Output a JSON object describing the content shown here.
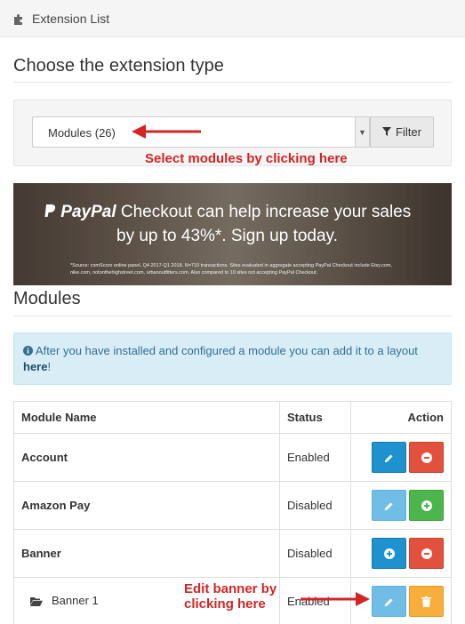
{
  "header": {
    "title": "Extension List",
    "icon": "puzzle-icon"
  },
  "choose": {
    "title": "Choose the extension type",
    "select_value": "Modules (26)",
    "filter_label": "Filter",
    "annotation": "Select modules by clicking here"
  },
  "banner": {
    "brand": "PayPal",
    "line1_rest": " Checkout can help increase your sales",
    "line2": "by up to 43%*. Sign up today.",
    "fineprint": "*Source: comScore online panel, Q4 2017-Q1 2018. N=710 transactions. Sites evaluated in aggregate accepting PayPal Checkout include Etsy.com, nike.com, notonthehighstreet.com, urbanoutfitters.com. Also compared to 10 sites not accepting PayPal Checkout."
  },
  "modules": {
    "title": "Modules",
    "alert_text": "After you have installed and configured a module you can add it to a layout",
    "alert_link": "here",
    "alert_suffix": "!",
    "columns": [
      "Module Name",
      "Status",
      "Action"
    ],
    "rows": [
      {
        "name": "Account",
        "status": "Enabled"
      },
      {
        "name": "Amazon Pay",
        "status": "Disabled"
      },
      {
        "name": "Banner",
        "status": "Disabled"
      },
      {
        "name": "Banner 1",
        "status": "Enabled"
      }
    ],
    "edit_annotation_line1": "Edit banner by",
    "edit_annotation_line2": "clicking here"
  },
  "colors": {
    "primary": "#1e91cf",
    "danger": "#e3503e",
    "success": "#4cb64c",
    "warning": "#f7ae3a",
    "annotation": "#d42424"
  }
}
